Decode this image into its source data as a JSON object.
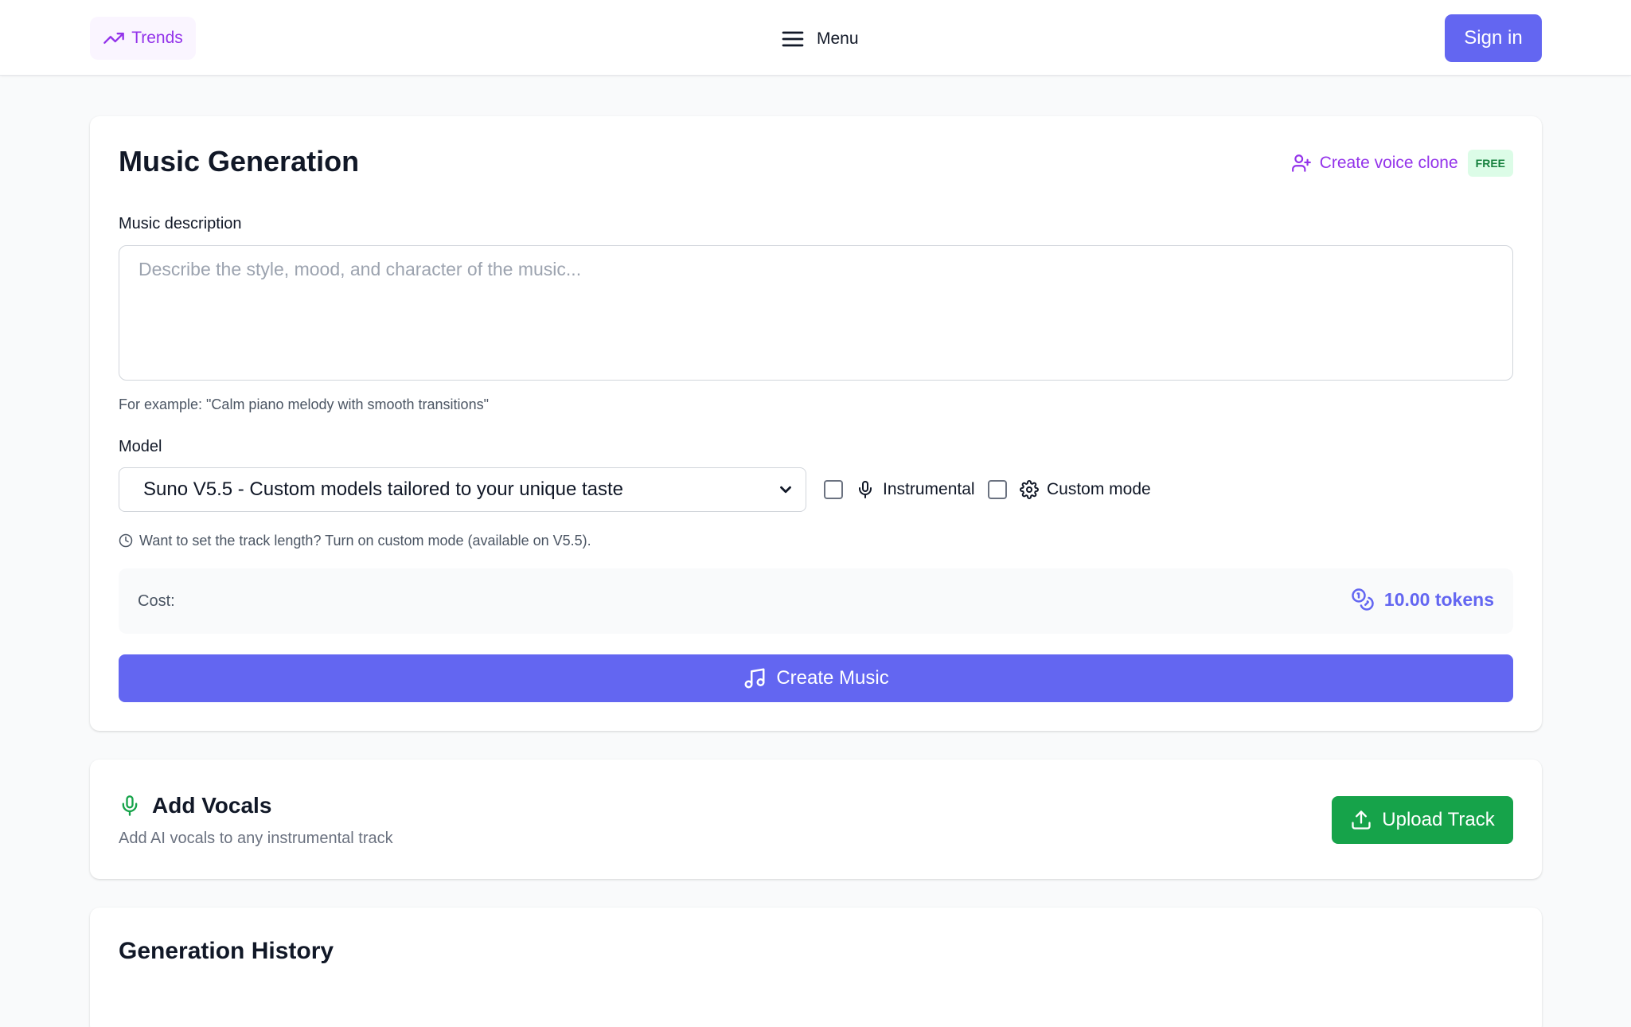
{
  "header": {
    "trends_label": "Trends",
    "menu_label": "Menu",
    "signin_label": "Sign in"
  },
  "generation": {
    "title": "Music Generation",
    "voice_clone_label": "Create voice clone",
    "free_badge": "FREE",
    "description_label": "Music description",
    "description_placeholder": "Describe the style, mood, and character of the music...",
    "description_value": "",
    "example_hint": "For example: \"Calm piano melody with smooth transitions\"",
    "model_label": "Model",
    "model_selected": "Suno V5.5 - Custom models tailored to your unique taste",
    "instrumental_label": "Instrumental",
    "instrumental_checked": false,
    "custom_mode_label": "Custom mode",
    "custom_mode_checked": false,
    "length_hint": "Want to set the track length? Turn on custom mode (available on V5.5).",
    "cost_label": "Cost:",
    "cost_value": "10.00 tokens",
    "create_button": "Create Music"
  },
  "vocals": {
    "title": "Add Vocals",
    "subtitle": "Add AI vocals to any instrumental track",
    "upload_button": "Upload Track"
  },
  "history": {
    "title": "Generation History"
  },
  "colors": {
    "primary": "#6366f1",
    "purple": "#9333ea",
    "green": "#16a34a",
    "free_bg": "#dcfce7",
    "background": "#f9fafb"
  },
  "icons": {
    "trends": "trending-up-icon",
    "menu": "hamburger-menu-icon",
    "voice_clone": "user-plus-icon",
    "instrumental": "microphone-icon",
    "custom_mode": "gear-icon",
    "length_hint": "clock-icon",
    "cost": "coins-icon",
    "create": "music-note-icon",
    "vocals": "microphone-icon",
    "upload": "upload-icon"
  }
}
